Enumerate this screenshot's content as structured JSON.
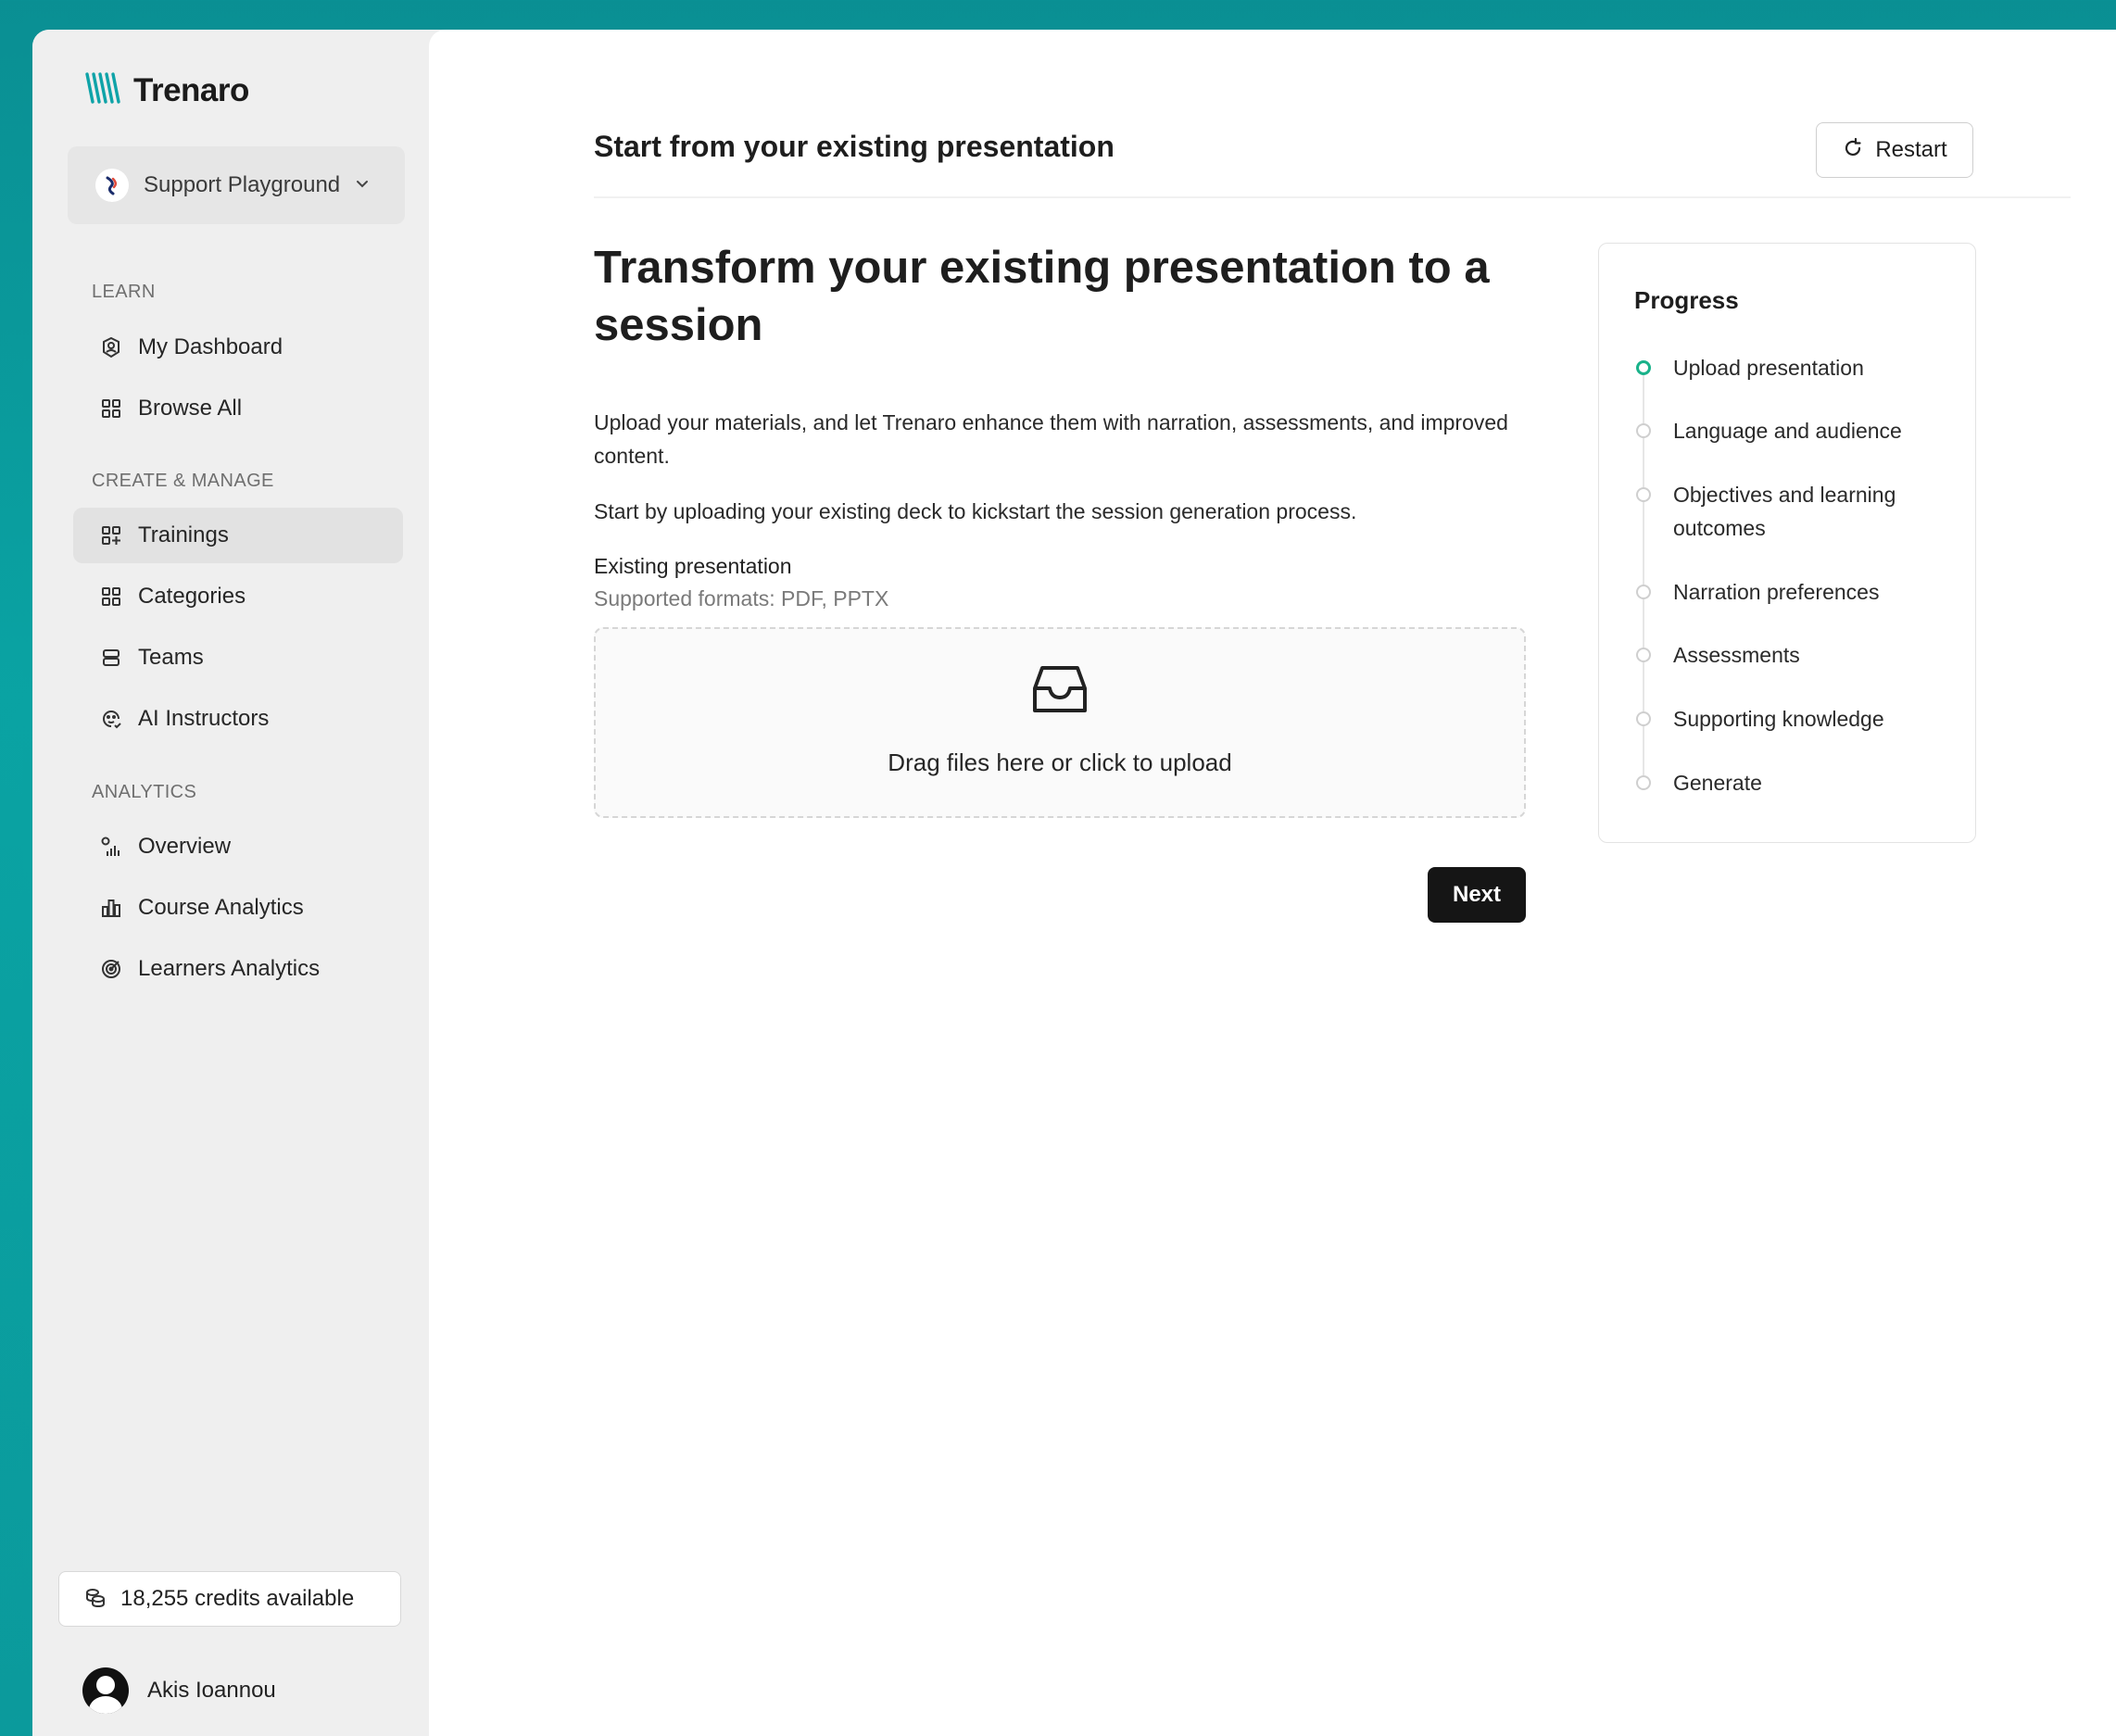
{
  "brand": {
    "name": "Trenaro",
    "accent": "#0fa3a8"
  },
  "workspace": {
    "name": "Support Playground"
  },
  "sidebar": {
    "sections": [
      {
        "label": "LEARN"
      },
      {
        "label": "CREATE & MANAGE"
      },
      {
        "label": "ANALYTICS"
      }
    ],
    "items": [
      {
        "label": "My Dashboard",
        "icon": "dashboard-icon"
      },
      {
        "label": "Browse All",
        "icon": "grid-icon"
      },
      {
        "label": "Trainings",
        "icon": "grid-plus-icon",
        "active": true
      },
      {
        "label": "Categories",
        "icon": "grid-icon"
      },
      {
        "label": "Teams",
        "icon": "stack-icon"
      },
      {
        "label": "AI Instructors",
        "icon": "bot-face-icon"
      },
      {
        "label": "Overview",
        "icon": "overview-chart-icon"
      },
      {
        "label": "Course Analytics",
        "icon": "bar-chart-icon"
      },
      {
        "label": "Learners Analytics",
        "icon": "target-icon"
      }
    ],
    "credits": "18,255 credits available",
    "user": "Akis Ioannou"
  },
  "header": {
    "title": "Start from your existing presentation",
    "restart_label": "Restart"
  },
  "main": {
    "heading": "Transform your existing presentation to a session",
    "intro": "Upload your materials, and let Trenaro enhance them with narration, assessments, and improved content.",
    "instruction": "Start by uploading your existing deck to kickstart the session generation process.",
    "field_label": "Existing presentation",
    "field_hint": "Supported formats: PDF, PPTX",
    "dropzone_label": "Drag files here or click to upload",
    "next_label": "Next"
  },
  "progress": {
    "title": "Progress",
    "current_color": "#19b28a",
    "steps": [
      {
        "label": "Upload presentation",
        "current": true
      },
      {
        "label": "Language and audience"
      },
      {
        "label": "Objectives and learning outcomes"
      },
      {
        "label": "Narration preferences"
      },
      {
        "label": "Assessments"
      },
      {
        "label": "Supporting knowledge"
      },
      {
        "label": "Generate"
      }
    ]
  }
}
